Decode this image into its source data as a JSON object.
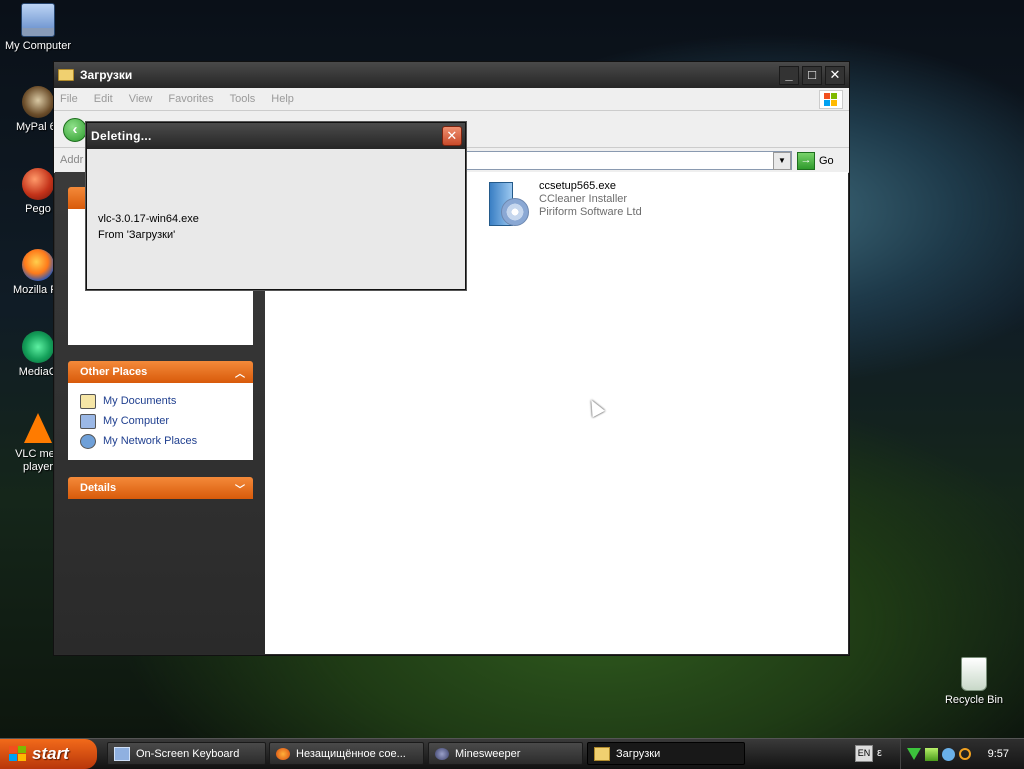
{
  "desktop": {
    "icons": [
      {
        "label": "My Computer"
      },
      {
        "label": "MyPal 6"
      },
      {
        "label": "Pego"
      },
      {
        "label": "Mozilla Fir"
      },
      {
        "label": "MediaG"
      },
      {
        "label": "VLC med\nplayer"
      },
      {
        "label": "Recycle Bin"
      }
    ]
  },
  "window": {
    "title": "Загрузки",
    "menu": [
      "File",
      "Edit",
      "View",
      "Favorites",
      "Tools",
      "Help"
    ],
    "address_label": "Addr",
    "go_label": "Go",
    "panels": {
      "other_places": {
        "title": "Other Places",
        "items": [
          "My Documents",
          "My Computer",
          "My Network Places"
        ]
      },
      "details": {
        "title": "Details"
      }
    },
    "files": [
      {
        "name": "ccsetup565.exe",
        "description": "CCleaner Installer",
        "company": "Piriform Software Ltd"
      }
    ]
  },
  "dialog": {
    "title": "Deleting...",
    "file": "vlc-3.0.17-win64.exe",
    "from": "From 'Загрузки'"
  },
  "taskbar": {
    "start_label": "start",
    "tasks": [
      {
        "label": "On-Screen Keyboard"
      },
      {
        "label": "Незащищённое сое..."
      },
      {
        "label": "Minesweeper"
      },
      {
        "label": "Загрузки"
      }
    ],
    "language": "EN",
    "language_extra": "ε",
    "clock": "9:57"
  },
  "colors": {
    "accent": "#e8651a",
    "link": "#1f3f8f"
  }
}
